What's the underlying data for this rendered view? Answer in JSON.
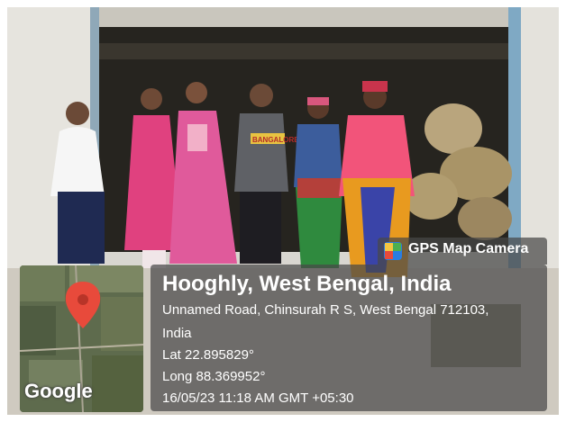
{
  "badge": {
    "label": "GPS Map Camera",
    "icon": "gps-map-camera-app-icon"
  },
  "location": {
    "title": "Hooghly, West Bengal, India",
    "address_line_1": "Unnamed Road, Chinsurah R S, West Bengal 712103,",
    "address_line_2": "India",
    "latitude": "Lat 22.895829°",
    "longitude": "Long 88.369952°",
    "datetime": "16/05/23 11:18 AM GMT +05:30"
  },
  "map": {
    "provider": "Google",
    "pin_color": "#e84a3b"
  },
  "shirt_print": "BANGALORE",
  "colors": {
    "overlay": "#484848",
    "pin": "#e84a3b",
    "app_icon": "#2a7de1"
  }
}
